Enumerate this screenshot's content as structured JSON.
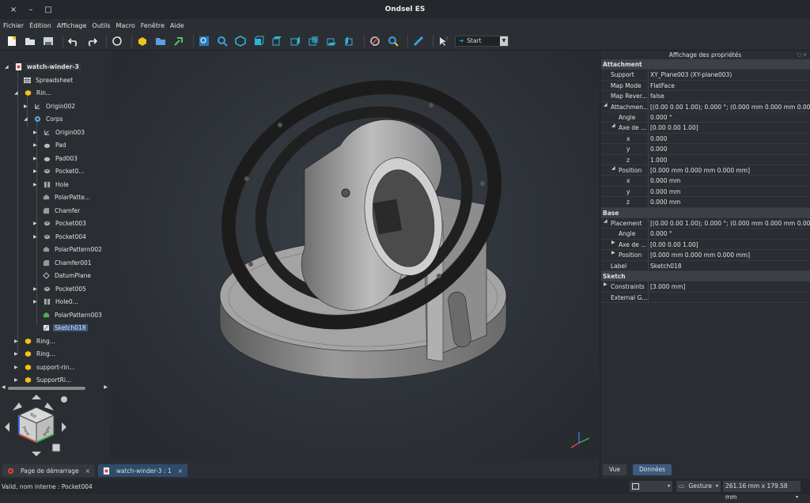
{
  "window": {
    "title": "Ondsel ES",
    "close": "×",
    "minimize": "–",
    "maximize": "□"
  },
  "menu": [
    "Fichier",
    "Édition",
    "Affichage",
    "Outils",
    "Macro",
    "Fenêtre",
    "Aide"
  ],
  "toolbar": {
    "workbench": "Start"
  },
  "tree": {
    "root": "watch-winder-3",
    "items": [
      {
        "label": "Spreadsheet"
      },
      {
        "label": "Rin..."
      },
      {
        "label": "Origin002"
      },
      {
        "label": "Corps"
      },
      {
        "label": "Origin003"
      },
      {
        "label": "Pad"
      },
      {
        "label": "Pad003"
      },
      {
        "label": "Pocket0..."
      },
      {
        "label": "Hole"
      },
      {
        "label": "PolarPatte..."
      },
      {
        "label": "Chamfer"
      },
      {
        "label": "Pocket003"
      },
      {
        "label": "Pocket004"
      },
      {
        "label": "PolarPattern002"
      },
      {
        "label": "Chamfer001"
      },
      {
        "label": "DatumPlane"
      },
      {
        "label": "Pocket005"
      },
      {
        "label": "Hole0..."
      },
      {
        "label": "PolarPattern003"
      },
      {
        "label": "Sketch018"
      },
      {
        "label": "Ring..."
      },
      {
        "label": "Ring..."
      },
      {
        "label": "support-rin..."
      },
      {
        "label": "SupportRi..."
      }
    ]
  },
  "properties": {
    "title": "Affichage des propriétés",
    "rows": [
      {
        "k": "Attachment",
        "v": "",
        "group": true
      },
      {
        "k": "Support",
        "v": "XY_Plane003 (XY-plane003)"
      },
      {
        "k": "Map Mode",
        "v": "FlatFace"
      },
      {
        "k": "Map Rever...",
        "v": "false"
      },
      {
        "k": "Attachmen...",
        "v": "[(0.00 0.00 1.00); 0.000 °; (0.000 mm  0.000 mm  0.000 m..."
      },
      {
        "k": "Angle",
        "v": "0.000 °"
      },
      {
        "k": "Axe de ...",
        "v": "[0.00 0.00 1.00]"
      },
      {
        "k": "x",
        "v": "0.000"
      },
      {
        "k": "y",
        "v": "0.000"
      },
      {
        "k": "z",
        "v": "1.000"
      },
      {
        "k": "Position",
        "v": "[0.000 mm  0.000 mm  0.000 mm]"
      },
      {
        "k": "x",
        "v": "0.000 mm"
      },
      {
        "k": "y",
        "v": "0.000 mm"
      },
      {
        "k": "z",
        "v": "0.000 mm"
      },
      {
        "k": "Base",
        "v": "",
        "group": true
      },
      {
        "k": "Placement",
        "v": "[(0.00 0.00 1.00); 0.000 °; (0.000 mm  0.000 mm  0.000 m..."
      },
      {
        "k": "Angle",
        "v": "0.000 °"
      },
      {
        "k": "Axe de ...",
        "v": "[0.00 0.00 1.00]"
      },
      {
        "k": "Position",
        "v": "[0.000 mm  0.000 mm  0.000 mm]"
      },
      {
        "k": "Label",
        "v": "Sketch018"
      },
      {
        "k": "Sketch",
        "v": "",
        "group": true
      },
      {
        "k": "Constraints",
        "v": "[3.000 mm]"
      },
      {
        "k": "External G...",
        "v": ""
      }
    ],
    "tabs": [
      "Vue",
      "Données"
    ]
  },
  "doc_tabs": [
    {
      "label": "Page de démarrage",
      "close": "×"
    },
    {
      "label": "watch-winder-3 : 1",
      "close": "×"
    }
  ],
  "status": {
    "message": "Valid, nom interne : Pocket004",
    "nav_style": "Gesture",
    "dimensions": "261.16 mm x 179.58 mm"
  },
  "navcube": {
    "face_front": "Front",
    "face_top": "Top",
    "face_right": "Right"
  },
  "colors": {
    "accent": "#3d5a80",
    "model": "#9a9a9a",
    "ring": "#1c1c1c"
  }
}
